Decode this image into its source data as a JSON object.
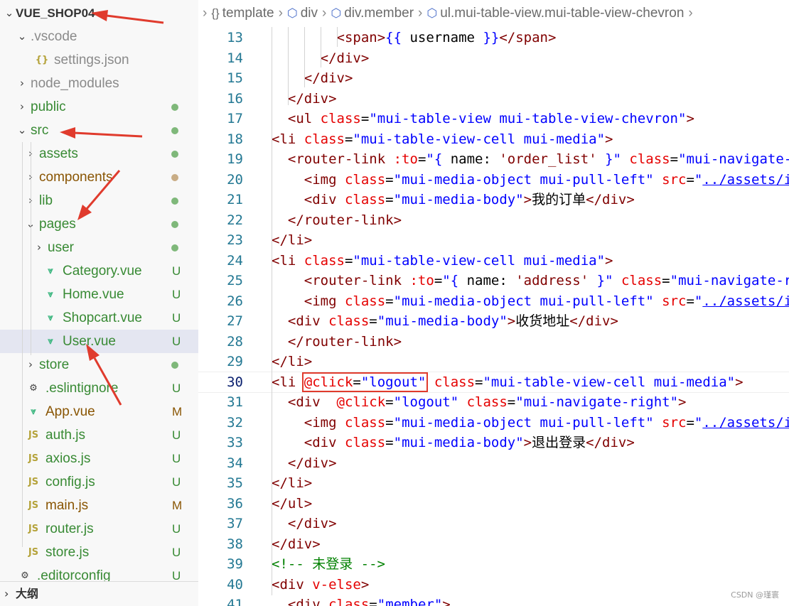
{
  "explorer": {
    "root": "VUE_SHOP04",
    "items": [
      {
        "name": ".vscode",
        "kind": "folder",
        "open": true,
        "depth": 1,
        "color": "gray",
        "badge": ""
      },
      {
        "name": "settings.json",
        "kind": "json",
        "depth": 2,
        "color": "gray",
        "badge": ""
      },
      {
        "name": "node_modules",
        "kind": "folder",
        "open": false,
        "depth": 1,
        "color": "gray",
        "badge": ""
      },
      {
        "name": "public",
        "kind": "folder",
        "open": false,
        "depth": 1,
        "color": "green",
        "badge": "dot"
      },
      {
        "name": "src",
        "kind": "folder",
        "open": true,
        "depth": 1,
        "color": "green",
        "badge": "dot"
      },
      {
        "name": "assets",
        "kind": "folder",
        "open": false,
        "depth": 2,
        "color": "green",
        "badge": "dot"
      },
      {
        "name": "components",
        "kind": "folder",
        "open": false,
        "depth": 2,
        "color": "brown",
        "badge": "dot-brown"
      },
      {
        "name": "lib",
        "kind": "folder",
        "open": false,
        "depth": 2,
        "color": "green",
        "badge": "dot"
      },
      {
        "name": "pages",
        "kind": "folder",
        "open": true,
        "depth": 2,
        "color": "green",
        "badge": "dot"
      },
      {
        "name": "user",
        "kind": "folder",
        "open": false,
        "depth": 3,
        "color": "green",
        "badge": "dot"
      },
      {
        "name": "Category.vue",
        "kind": "vue",
        "depth": 3,
        "color": "green",
        "badge": "U"
      },
      {
        "name": "Home.vue",
        "kind": "vue",
        "depth": 3,
        "color": "green",
        "badge": "U"
      },
      {
        "name": "Shopcart.vue",
        "kind": "vue",
        "depth": 3,
        "color": "green",
        "badge": "U"
      },
      {
        "name": "User.vue",
        "kind": "vue",
        "depth": 3,
        "color": "green",
        "badge": "U",
        "selected": true
      },
      {
        "name": "store",
        "kind": "folder",
        "open": false,
        "depth": 2,
        "color": "green",
        "badge": "dot"
      },
      {
        "name": ".eslintignore",
        "kind": "gear",
        "depth": 1,
        "color": "green",
        "badge": "U"
      },
      {
        "name": "App.vue",
        "kind": "vue",
        "depth": 1,
        "color": "brown",
        "badge": "M"
      },
      {
        "name": "auth.js",
        "kind": "js",
        "depth": 1,
        "color": "green",
        "badge": "U"
      },
      {
        "name": "axios.js",
        "kind": "js",
        "depth": 1,
        "color": "green",
        "badge": "U"
      },
      {
        "name": "config.js",
        "kind": "js",
        "depth": 1,
        "color": "green",
        "badge": "U"
      },
      {
        "name": "main.js",
        "kind": "js",
        "depth": 1,
        "color": "brown",
        "badge": "M"
      },
      {
        "name": "router.js",
        "kind": "js",
        "depth": 1,
        "color": "green",
        "badge": "U"
      },
      {
        "name": "store.js",
        "kind": "js",
        "depth": 1,
        "color": "green",
        "badge": "U"
      },
      {
        "name": ".editorconfig",
        "kind": "gear",
        "depth": 0,
        "color": "green",
        "badge": "U"
      }
    ],
    "outline_label": "大纲"
  },
  "breadcrumb": [
    "template",
    "div",
    "div.member",
    "ul.mui-table-view.mui-table-view-chevron"
  ],
  "editor": {
    "active_line": 30,
    "lines": [
      {
        "n": 13,
        "tokens": [
          [
            "plain",
            "        "
          ],
          [
            "tag",
            "<span>"
          ],
          [
            "brace",
            "{{ "
          ],
          [
            "plain",
            "username"
          ],
          [
            "brace",
            " }}"
          ],
          [
            "tag",
            "</span>"
          ]
        ]
      },
      {
        "n": 14,
        "tokens": [
          [
            "plain",
            "      "
          ],
          [
            "tag",
            "</div>"
          ]
        ]
      },
      {
        "n": 15,
        "tokens": [
          [
            "plain",
            "    "
          ],
          [
            "tag",
            "</div>"
          ]
        ]
      },
      {
        "n": 16,
        "tokens": [
          [
            "plain",
            "  "
          ],
          [
            "tag",
            "</div>"
          ]
        ]
      },
      {
        "n": 17,
        "tokens": [
          [
            "plain",
            "  "
          ],
          [
            "tag",
            "<ul "
          ],
          [
            "attr",
            "class"
          ],
          [
            "plain",
            "="
          ],
          [
            "str",
            "\"mui-table-view mui-table-view-chevron\""
          ],
          [
            "tag",
            ">"
          ]
        ]
      },
      {
        "n": 18,
        "tokens": [
          [
            "tag",
            "<li "
          ],
          [
            "attr",
            "class"
          ],
          [
            "plain",
            "="
          ],
          [
            "str",
            "\"mui-table-view-cell mui-media\""
          ],
          [
            "tag",
            ">"
          ]
        ]
      },
      {
        "n": 19,
        "tokens": [
          [
            "plain",
            "  "
          ],
          [
            "tag",
            "<router-link "
          ],
          [
            "attr",
            ":to"
          ],
          [
            "plain",
            "="
          ],
          [
            "str",
            "\"{ "
          ],
          [
            "plain",
            "name: "
          ],
          [
            "tag",
            "'order_list'"
          ],
          [
            "str",
            " }\""
          ],
          [
            "plain",
            " "
          ],
          [
            "attr",
            "class"
          ],
          [
            "plain",
            "="
          ],
          [
            "str",
            "\"mui-navigate-right\""
          ]
        ]
      },
      {
        "n": 20,
        "tokens": [
          [
            "plain",
            "    "
          ],
          [
            "tag",
            "<img "
          ],
          [
            "attr",
            "class"
          ],
          [
            "plain",
            "="
          ],
          [
            "str",
            "\"mui-media-object mui-pull-left\""
          ],
          [
            "plain",
            " "
          ],
          [
            "attr",
            "src"
          ],
          [
            "plain",
            "="
          ],
          [
            "str",
            "\""
          ],
          [
            "link",
            "../assets/img/order.png"
          ]
        ]
      },
      {
        "n": 21,
        "tokens": [
          [
            "plain",
            "    "
          ],
          [
            "tag",
            "<div "
          ],
          [
            "attr",
            "class"
          ],
          [
            "plain",
            "="
          ],
          [
            "str",
            "\"mui-media-body\""
          ],
          [
            "tag",
            ">"
          ],
          [
            "plain",
            "我的订单"
          ],
          [
            "tag",
            "</div>"
          ]
        ]
      },
      {
        "n": 22,
        "tokens": [
          [
            "plain",
            "  "
          ],
          [
            "tag",
            "</router-link>"
          ]
        ]
      },
      {
        "n": 23,
        "tokens": [
          [
            "tag",
            "</li>"
          ]
        ]
      },
      {
        "n": 24,
        "tokens": [
          [
            "tag",
            "<li "
          ],
          [
            "attr",
            "class"
          ],
          [
            "plain",
            "="
          ],
          [
            "str",
            "\"mui-table-view-cell mui-media\""
          ],
          [
            "tag",
            ">"
          ]
        ]
      },
      {
        "n": 25,
        "tokens": [
          [
            "plain",
            "    "
          ],
          [
            "tag",
            "<router-link "
          ],
          [
            "attr",
            ":to"
          ],
          [
            "plain",
            "="
          ],
          [
            "str",
            "\"{ "
          ],
          [
            "plain",
            "name: "
          ],
          [
            "tag",
            "'address'"
          ],
          [
            "str",
            " }\""
          ],
          [
            "plain",
            " "
          ],
          [
            "attr",
            "class"
          ],
          [
            "plain",
            "="
          ],
          [
            "str",
            "\"mui-navigate-right\""
          ]
        ]
      },
      {
        "n": 26,
        "tokens": [
          [
            "plain",
            "    "
          ],
          [
            "tag",
            "<img "
          ],
          [
            "attr",
            "class"
          ],
          [
            "plain",
            "="
          ],
          [
            "str",
            "\"mui-media-object mui-pull-left\""
          ],
          [
            "plain",
            " "
          ],
          [
            "attr",
            "src"
          ],
          [
            "plain",
            "="
          ],
          [
            "str",
            "\""
          ],
          [
            "link",
            "../assets/img/address.png"
          ]
        ]
      },
      {
        "n": 27,
        "tokens": [
          [
            "plain",
            "  "
          ],
          [
            "tag",
            "<div "
          ],
          [
            "attr",
            "class"
          ],
          [
            "plain",
            "="
          ],
          [
            "str",
            "\"mui-media-body\""
          ],
          [
            "tag",
            ">"
          ],
          [
            "plain",
            "收货地址"
          ],
          [
            "tag",
            "</div>"
          ]
        ]
      },
      {
        "n": 28,
        "tokens": [
          [
            "plain",
            "  "
          ],
          [
            "tag",
            "</router-link>"
          ]
        ]
      },
      {
        "n": 29,
        "tokens": [
          [
            "tag",
            "</li>"
          ]
        ]
      },
      {
        "n": 30,
        "tokens": [
          [
            "tag",
            "<li "
          ],
          [
            "box",
            "@click=\"logout\""
          ],
          [
            "plain",
            " "
          ],
          [
            "attr",
            "class"
          ],
          [
            "plain",
            "="
          ],
          [
            "str",
            "\"mui-table-view-cell mui-media\""
          ],
          [
            "tag",
            ">"
          ]
        ]
      },
      {
        "n": 31,
        "tokens": [
          [
            "plain",
            "  "
          ],
          [
            "tag",
            "<div  "
          ],
          [
            "attr",
            "@click"
          ],
          [
            "plain",
            "="
          ],
          [
            "str",
            "\"logout\""
          ],
          [
            "plain",
            " "
          ],
          [
            "attr",
            "class"
          ],
          [
            "plain",
            "="
          ],
          [
            "str",
            "\"mui-navigate-right\""
          ],
          [
            "tag",
            ">"
          ]
        ]
      },
      {
        "n": 32,
        "tokens": [
          [
            "plain",
            "    "
          ],
          [
            "tag",
            "<img "
          ],
          [
            "attr",
            "class"
          ],
          [
            "plain",
            "="
          ],
          [
            "str",
            "\"mui-media-object mui-pull-left\""
          ],
          [
            "plain",
            " "
          ],
          [
            "attr",
            "src"
          ],
          [
            "plain",
            "="
          ],
          [
            "str",
            "\""
          ],
          [
            "link",
            "../assets/img/logout.png"
          ]
        ]
      },
      {
        "n": 33,
        "tokens": [
          [
            "plain",
            "    "
          ],
          [
            "tag",
            "<div "
          ],
          [
            "attr",
            "class"
          ],
          [
            "plain",
            "="
          ],
          [
            "str",
            "\"mui-media-body\""
          ],
          [
            "tag",
            ">"
          ],
          [
            "plain",
            "退出登录"
          ],
          [
            "tag",
            "</div>"
          ]
        ]
      },
      {
        "n": 34,
        "tokens": [
          [
            "plain",
            "  "
          ],
          [
            "tag",
            "</div>"
          ]
        ]
      },
      {
        "n": 35,
        "tokens": [
          [
            "tag",
            "</li>"
          ]
        ]
      },
      {
        "n": 36,
        "tokens": [
          [
            "tag",
            "</ul>"
          ]
        ]
      },
      {
        "n": 37,
        "tokens": [
          [
            "plain",
            "  "
          ],
          [
            "tag",
            "</div>"
          ]
        ]
      },
      {
        "n": 38,
        "tokens": [
          [
            "tag",
            "</div>"
          ]
        ]
      },
      {
        "n": 39,
        "tokens": [
          [
            "comment",
            "<!-- 未登录 -->"
          ]
        ]
      },
      {
        "n": 40,
        "tokens": [
          [
            "tag",
            "<div "
          ],
          [
            "attr",
            "v-else"
          ],
          [
            "tag",
            ">"
          ]
        ]
      },
      {
        "n": 41,
        "tokens": [
          [
            "plain",
            "  "
          ],
          [
            "tag",
            "<div "
          ],
          [
            "attr",
            "class"
          ],
          [
            "plain",
            "="
          ],
          [
            "str",
            "\"member\""
          ],
          [
            "tag",
            ">"
          ]
        ]
      }
    ]
  },
  "watermark": "CSDN @瑾寰",
  "colors": {
    "annotation_red": "#e03b2d"
  }
}
